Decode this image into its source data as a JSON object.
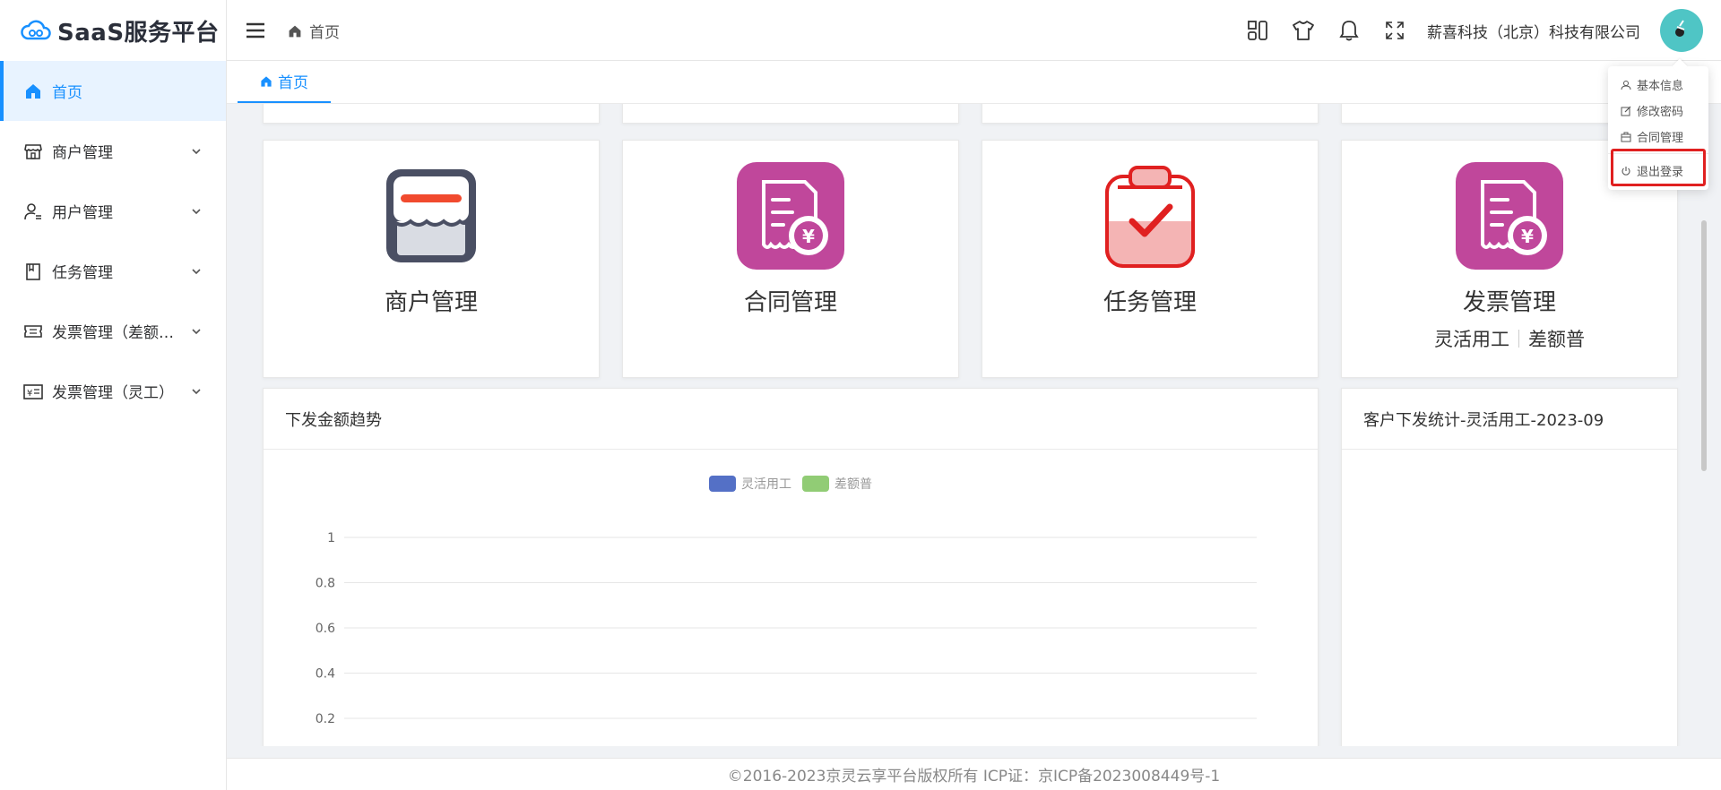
{
  "app": {
    "brand": "SaaS服务平台"
  },
  "sidebar": {
    "items": [
      {
        "label": "首页",
        "icon": "home-icon",
        "active": true
      },
      {
        "label": "商户管理",
        "icon": "store-icon"
      },
      {
        "label": "用户管理",
        "icon": "user-icon"
      },
      {
        "label": "任务管理",
        "icon": "task-icon"
      },
      {
        "label": "发票管理（差额普票）",
        "icon": "ticket-icon"
      },
      {
        "label": "发票管理（灵工）",
        "icon": "invoice-icon"
      }
    ]
  },
  "header": {
    "breadcrumb": "首页",
    "company": "薪喜科技（北京）科技有限公司",
    "icons": [
      "layout-icon",
      "shirt-icon",
      "bell-icon",
      "fullscreen-icon"
    ]
  },
  "tabs": [
    {
      "label": "首页"
    }
  ],
  "features": [
    {
      "title": "商户管理",
      "icon": "store-awning-icon"
    },
    {
      "title": "合同管理",
      "icon": "receipt-yen-icon"
    },
    {
      "title": "任务管理",
      "icon": "clipboard-check-icon"
    },
    {
      "title": "发票管理",
      "icon": "receipt-yen-icon",
      "sub": [
        "灵活用工",
        "差额普"
      ]
    }
  ],
  "panels": {
    "trend": {
      "title": "下发金额趋势"
    },
    "customer": {
      "title": "客户下发统计-灵活用工-2023-09"
    }
  },
  "chart_data": {
    "type": "line",
    "legend": [
      {
        "name": "灵活用工",
        "color": "#5470c6"
      },
      {
        "name": "差额普",
        "color": "#91cc75"
      }
    ],
    "y_ticks": [
      "1",
      "0.8",
      "0.6",
      "0.4",
      "0.2"
    ],
    "ylim": [
      0,
      1
    ],
    "series": [
      {
        "name": "灵活用工",
        "values": []
      },
      {
        "name": "差额普",
        "values": []
      }
    ],
    "grid": true,
    "legend_position": "top-center"
  },
  "dropdown": {
    "items": [
      {
        "label": "基本信息",
        "icon": "user-icon"
      },
      {
        "label": "修改密码",
        "icon": "edit-icon"
      },
      {
        "label": "合同管理",
        "icon": "briefcase-icon"
      }
    ],
    "logout": {
      "label": "退出登录",
      "icon": "power-icon"
    }
  },
  "footer": {
    "text": "©2016-2023京灵云享平台版权所有 ICP证：京ICP备2023008449号-1"
  },
  "colors": {
    "primary": "#1890ff",
    "magenta": "#c0479b",
    "red": "#e02020",
    "avatar": "#4fc5c5"
  }
}
